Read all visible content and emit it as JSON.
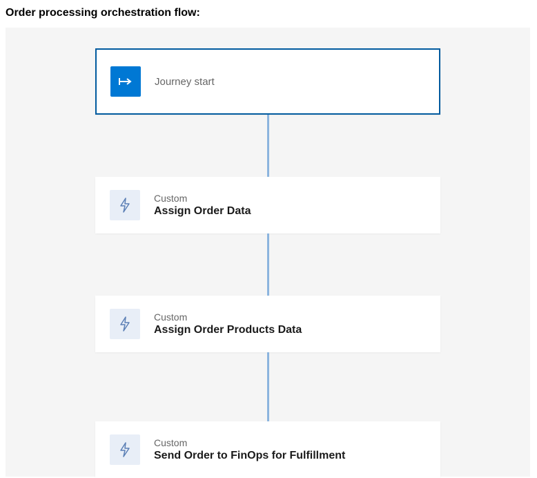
{
  "page_title": "Order processing orchestration flow:",
  "flow": {
    "start": {
      "label": "Journey start"
    },
    "steps": [
      {
        "type_label": "Custom",
        "title": "Assign Order Data"
      },
      {
        "type_label": "Custom",
        "title": "Assign Order Products Data"
      },
      {
        "type_label": "Custom",
        "title": "Send Order to FinOps for Fulfillment"
      }
    ]
  }
}
